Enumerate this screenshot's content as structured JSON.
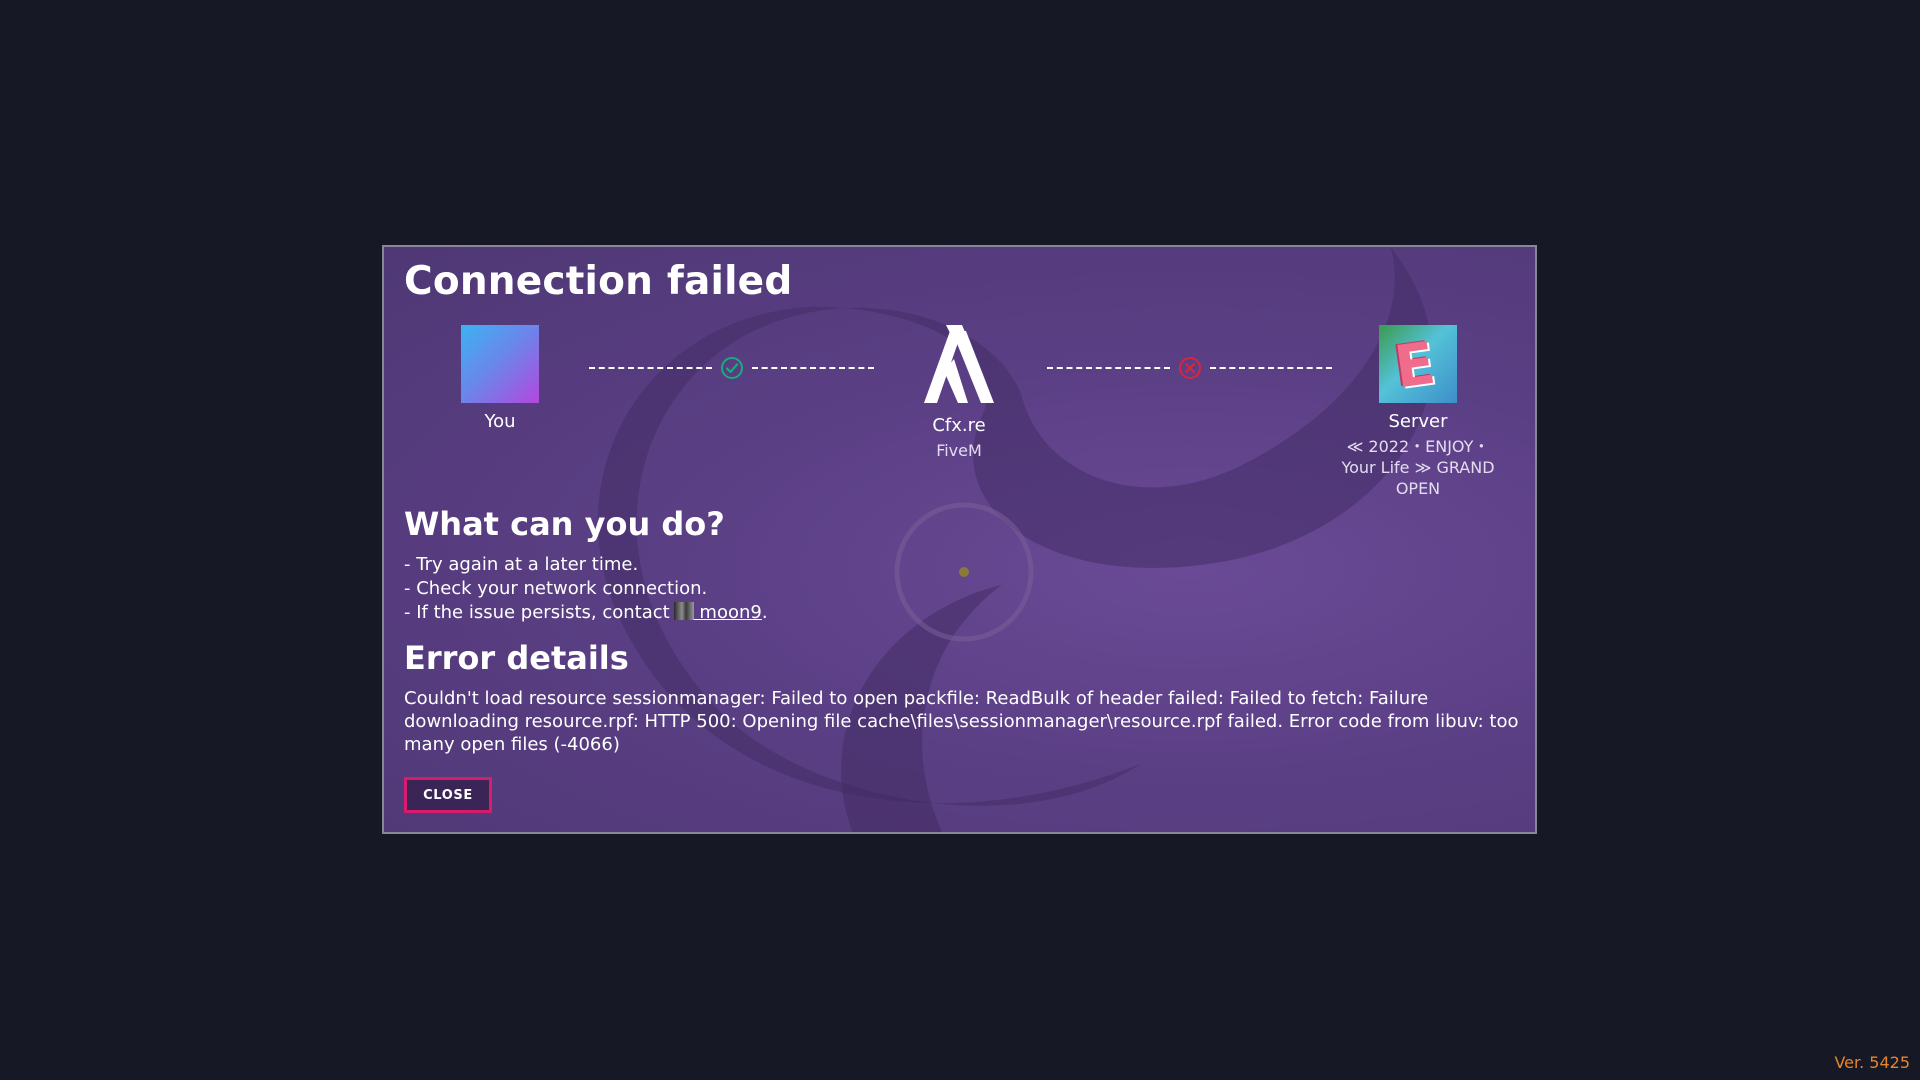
{
  "dialog": {
    "title": "Connection failed",
    "nodes": {
      "you": {
        "name": "You"
      },
      "cfx": {
        "name": "Cfx.re",
        "sub": "FiveM"
      },
      "server": {
        "name": "Server",
        "sub": "≪ 2022・ENJOY・ Your Life ≫ GRAND OPEN"
      }
    },
    "connections": [
      {
        "status": "ok",
        "icon": "check-circle-icon",
        "color": "#1ba97f"
      },
      {
        "status": "error",
        "icon": "x-circle-icon",
        "color": "#d7263d"
      }
    ],
    "what_can_you_do": {
      "title": "What can you do?",
      "tips": [
        "- Try again at a later time.",
        "- Check your network connection.",
        "- If the issue persists, contact"
      ],
      "contact_name": " moon9",
      "contact_suffix": "."
    },
    "error": {
      "title": "Error details",
      "message": "Couldn't load resource sessionmanager: Failed to open packfile: ReadBulk of header failed: Failed to fetch: Failure downloading resource.rpf: HTTP 500: Opening file cache\\files\\sessionmanager\\resource.rpf failed. Error code from libuv: too many open files (-4066)"
    },
    "close_label": "CLOSE"
  },
  "version": "Ver. 5425",
  "colors": {
    "background": "#161925",
    "dialog": "#5b3f85",
    "accent": "#d81b6d",
    "version": "#e8842a"
  }
}
